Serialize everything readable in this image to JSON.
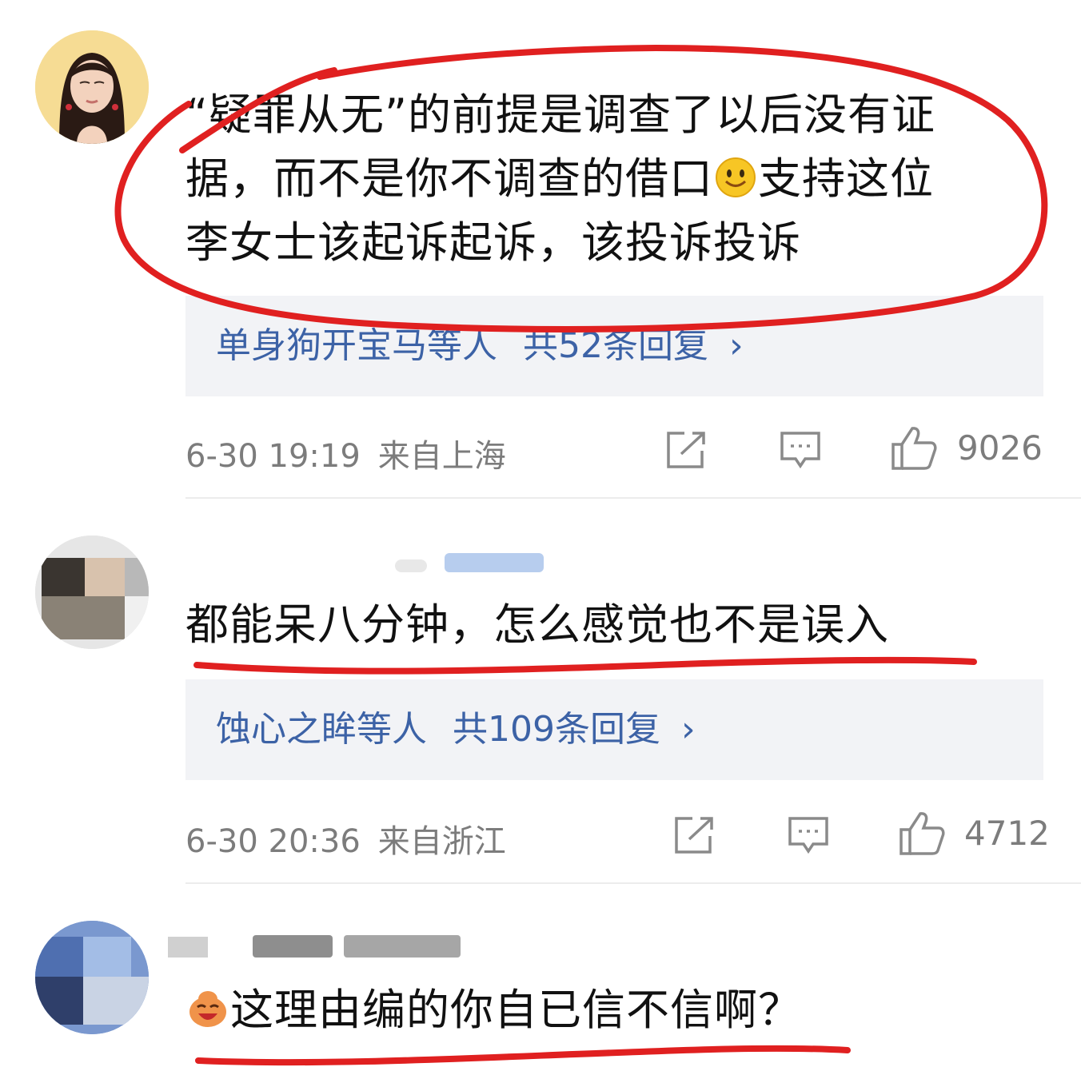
{
  "comments": [
    {
      "text_lines": [
        "“疑罪从无”的前提是调查了以后没有证",
        "据，而不是你不调查的借口",
        "支持这位",
        "李女士该起诉起诉，该投诉投诉"
      ],
      "emoji": "smile-emoji",
      "replies": {
        "names": "单身狗开宝马等人",
        "count": "共52条回复",
        "chevron": "›"
      },
      "time": "6-30 19:19",
      "location": "来自上海",
      "likes": "9026"
    },
    {
      "text_lines": [
        "都能呆八分钟，怎么感觉也不是误入"
      ],
      "replies": {
        "names": "蚀心之眸等人",
        "count": "共109条回复",
        "chevron": "›"
      },
      "time": "6-30 20:36",
      "location": "来自浙江",
      "likes": "4712"
    },
    {
      "text_lines": [
        "这理由编的你自已信不信啊？"
      ],
      "emoji": "laughing-emoji"
    }
  ],
  "icons": [
    "share-icon",
    "comment-icon",
    "thumbs-up-icon"
  ],
  "colors": {
    "link": "#3c62a6",
    "meta": "#7c7c7c",
    "reply_bg": "#f2f3f6",
    "annotation": "#e02020"
  }
}
